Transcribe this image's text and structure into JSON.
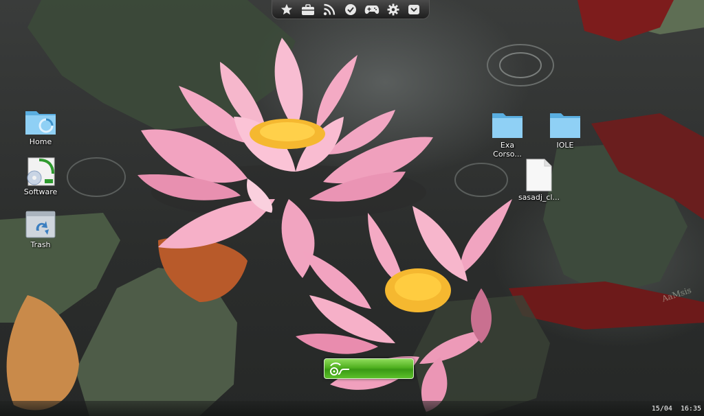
{
  "launcher": {
    "items": [
      {
        "name": "favorites",
        "icon": "star-icon"
      },
      {
        "name": "applications",
        "icon": "briefcase-icon"
      },
      {
        "name": "feeds",
        "icon": "rss-icon"
      },
      {
        "name": "tasks",
        "icon": "checkmark-icon"
      },
      {
        "name": "games",
        "icon": "gamepad-icon"
      },
      {
        "name": "settings",
        "icon": "gear-icon"
      },
      {
        "name": "tray",
        "icon": "inbox-icon"
      }
    ]
  },
  "desktop": {
    "left_icons": [
      {
        "label": "Home",
        "icon": "home-folder-icon"
      },
      {
        "label": "Software",
        "icon": "software-cd-icon"
      },
      {
        "label": "Trash",
        "icon": "trash-icon"
      }
    ],
    "right_icons": [
      {
        "label": "Exa\nCorso...",
        "label_line1": "Exa",
        "label_line2": "Corso...",
        "icon": "folder-icon"
      },
      {
        "label": "IOLE",
        "icon": "folder-icon"
      },
      {
        "label": "sasadj_cl...",
        "icon": "document-icon"
      }
    ]
  },
  "watermark": "AaMsis",
  "taskbar": {
    "date": "15/04",
    "time": "16:35"
  },
  "colors": {
    "launcher_bg": "#2a2a2a",
    "folder_blue": "#6fc0ee",
    "loadbar_green": "#4fb01f"
  }
}
